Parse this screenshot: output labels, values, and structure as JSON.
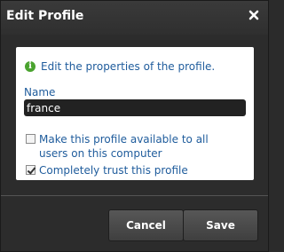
{
  "dialog": {
    "title": "Edit Profile",
    "close_icon": "close-icon"
  },
  "info": {
    "icon": "info-icon",
    "text": "Edit the properties of the profile."
  },
  "name_field": {
    "label": "Name",
    "value": "france"
  },
  "options": {
    "available_all_users": {
      "label": "Make this profile available to all users on this computer",
      "checked": false
    },
    "trust_profile": {
      "label": "Completely trust this profile",
      "checked": true
    }
  },
  "buttons": {
    "cancel": "Cancel",
    "save": "Save"
  }
}
